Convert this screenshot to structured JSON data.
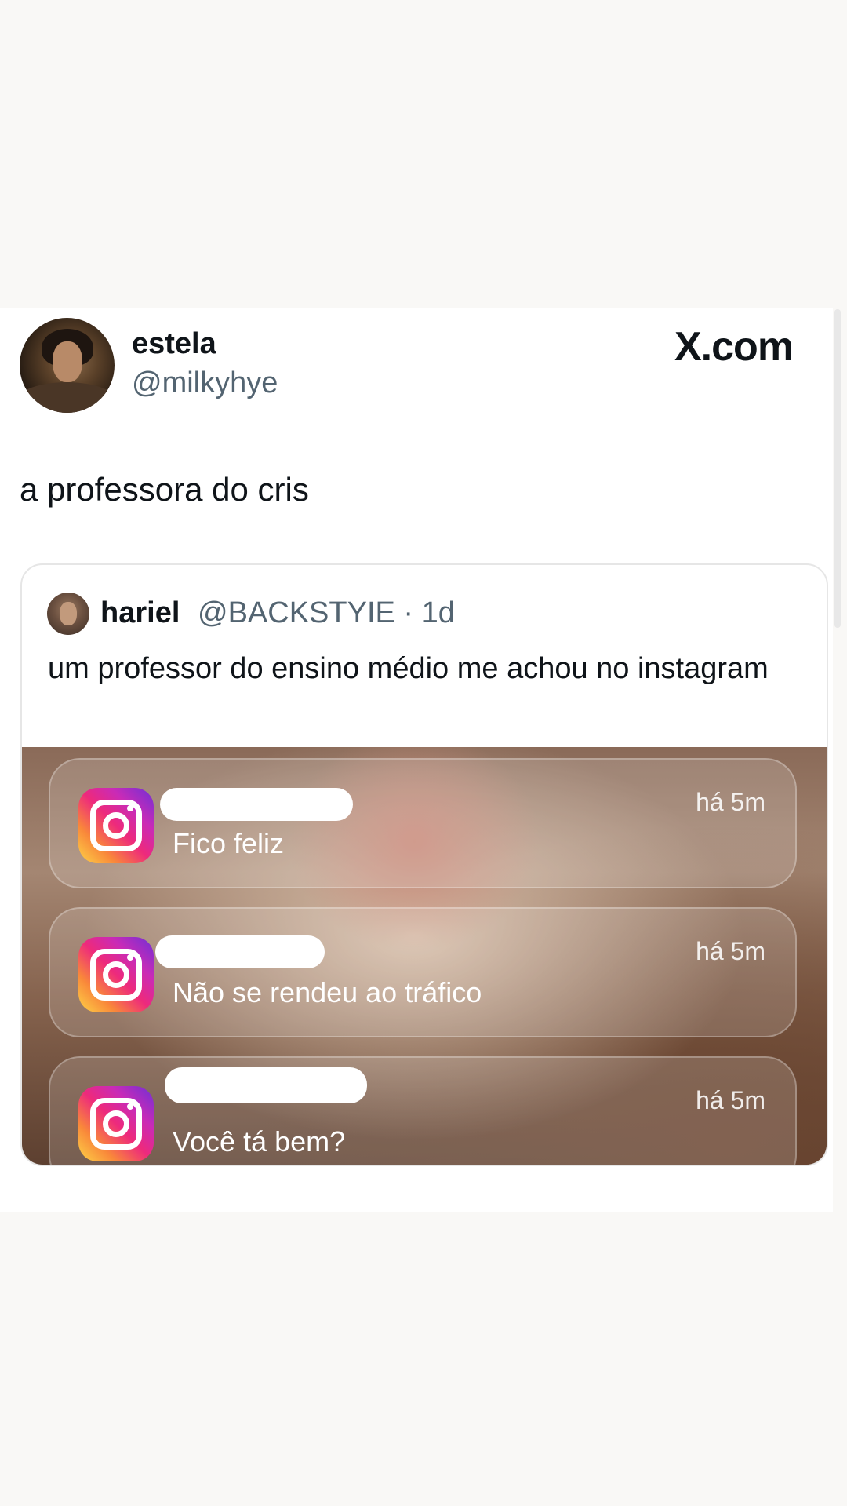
{
  "tweet": {
    "author_name": "estela",
    "author_handle": "@milkyhye",
    "brand": "X.com",
    "text": "a professora do cris"
  },
  "quoted_tweet": {
    "author_name": "hariel",
    "author_handle": "@BACKSTYIE · 1d",
    "text": "um professor do ensino médio me achou no instagram"
  },
  "notifications": [
    {
      "app_icon": "instagram-icon",
      "time": "há 5m",
      "message": "Fico feliz"
    },
    {
      "app_icon": "instagram-icon",
      "time": "há 5m",
      "message": "Não se rendeu ao tráfico"
    },
    {
      "app_icon": "instagram-icon",
      "time": "há 5m",
      "message": "Você tá bem?"
    }
  ]
}
